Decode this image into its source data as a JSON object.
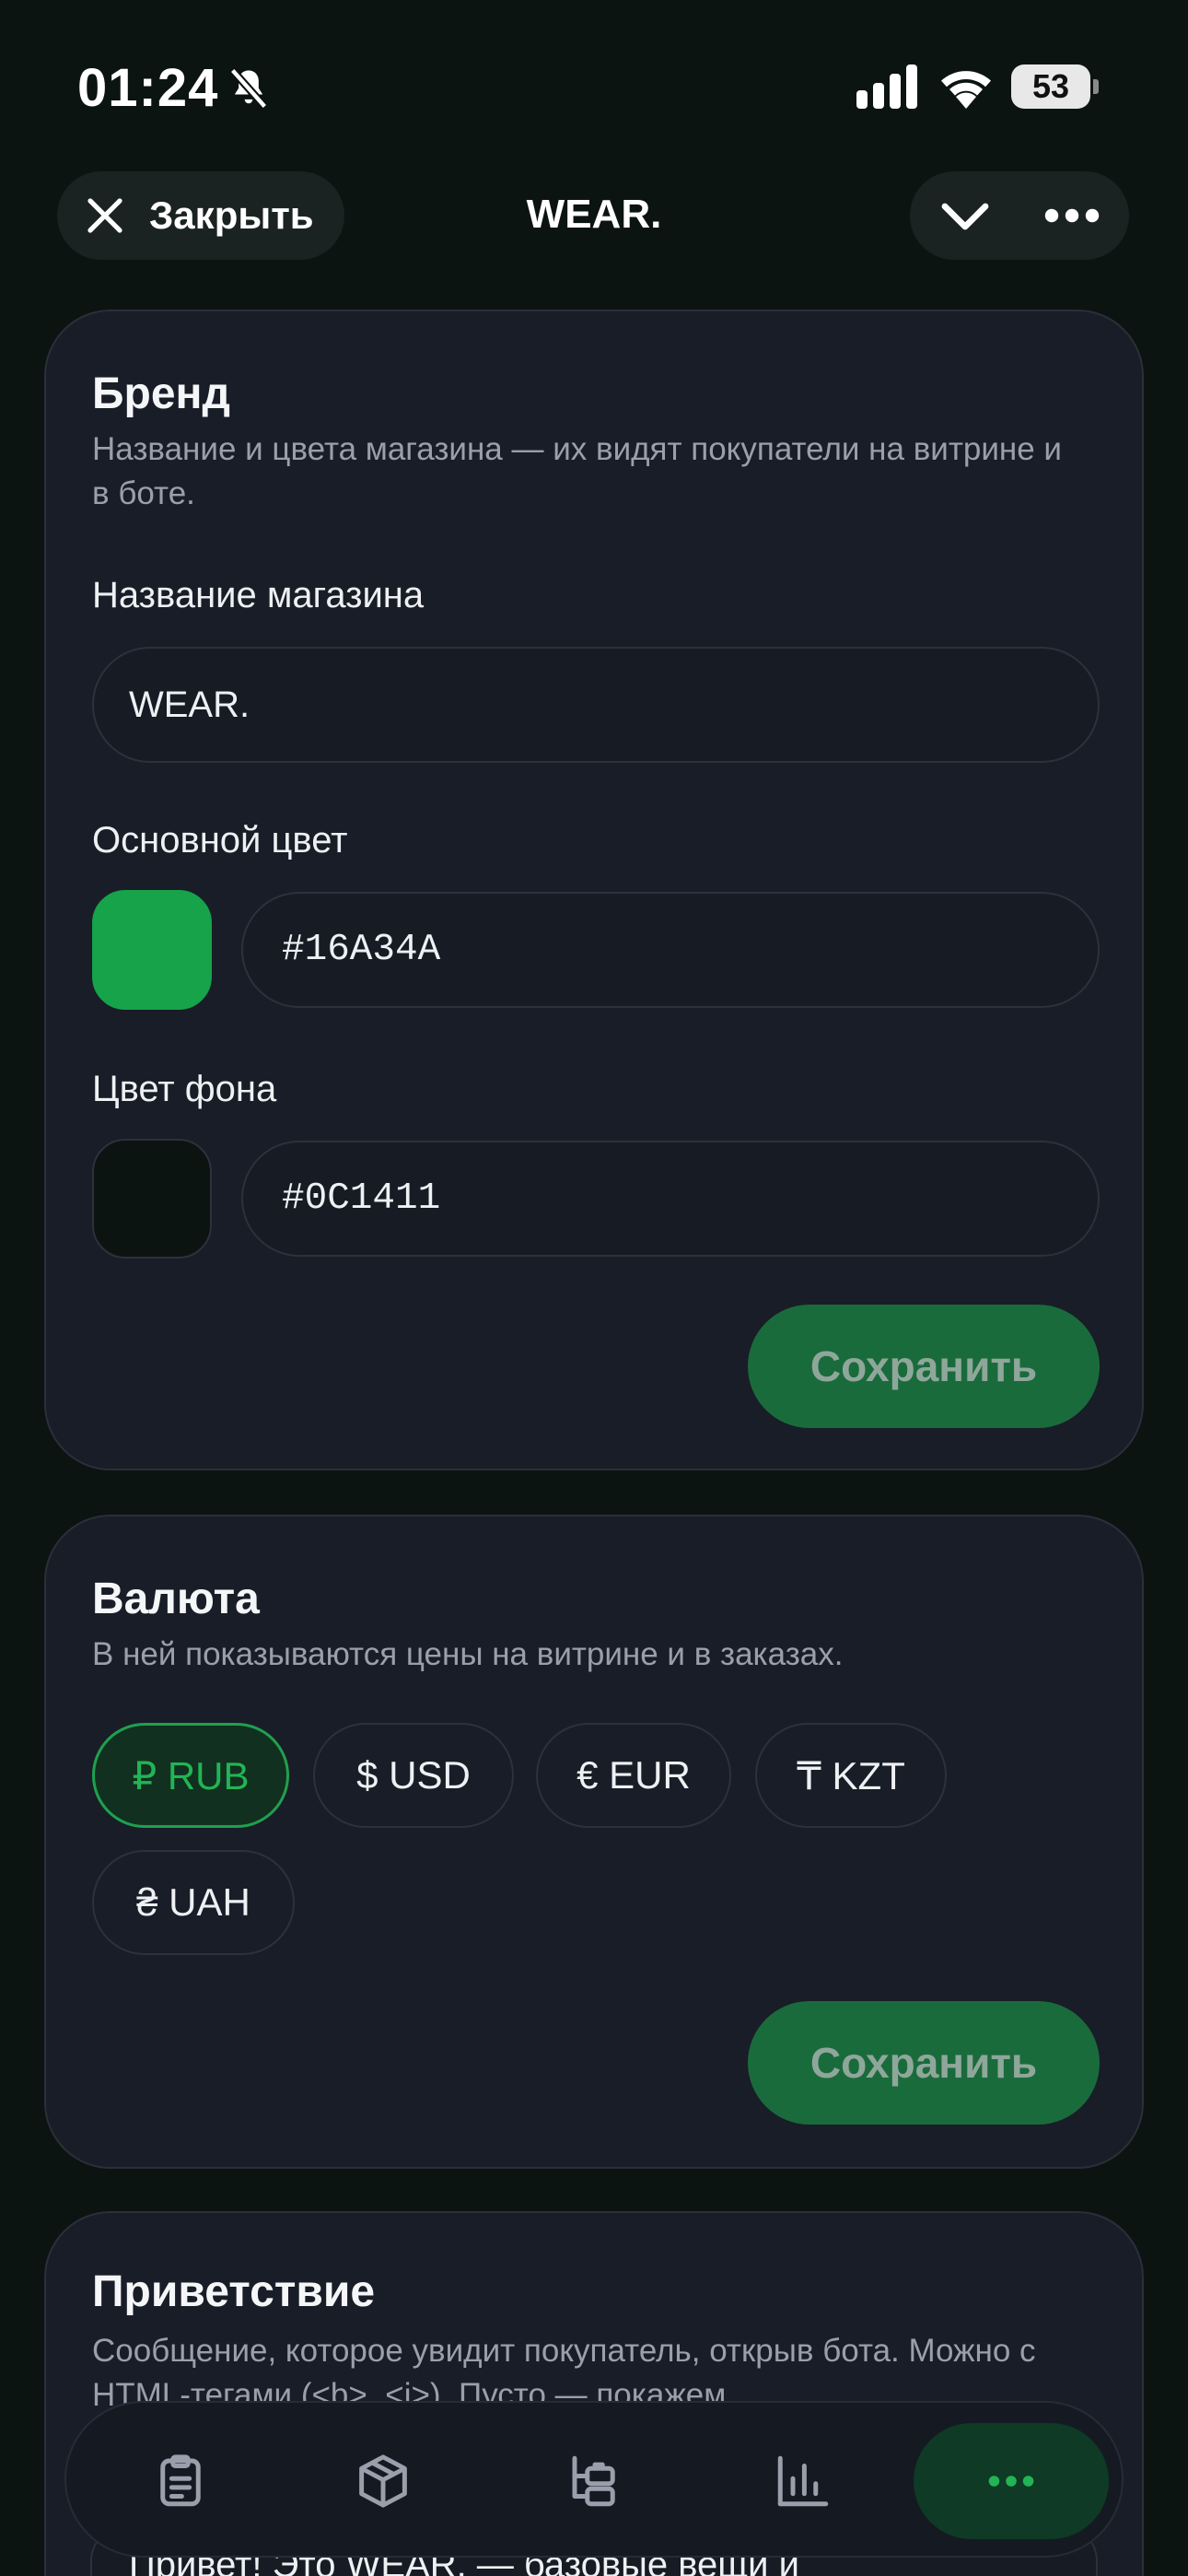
{
  "status_bar": {
    "time": "01:24",
    "battery": "53",
    "icons": [
      "bell-slash-icon",
      "signal-icon",
      "wifi-icon",
      "battery-icon"
    ]
  },
  "header": {
    "close_label": "Закрыть",
    "title": "WEAR.",
    "icons": [
      "close-icon",
      "chevron-down-icon",
      "more-icon"
    ]
  },
  "brand": {
    "title": "Бренд",
    "description": "Название и цвета магазина — их видят покупатели на витрине и в боте.",
    "store_name_label": "Название магазина",
    "store_name_value": "WEAR.",
    "primary_color_label": "Основной цвет",
    "primary_color_value": "#16A34A",
    "background_color_label": "Цвет фона",
    "background_color_value": "#0C1411",
    "save_label": "Сохранить"
  },
  "currency": {
    "title": "Валюта",
    "description": "В ней показываются цены на витрине и в заказах.",
    "options": [
      {
        "label": "₽ RUB",
        "selected": true
      },
      {
        "label": "$ USD",
        "selected": false
      },
      {
        "label": "€ EUR",
        "selected": false
      },
      {
        "label": "₸ KZT",
        "selected": false
      },
      {
        "label": "₴ UAH",
        "selected": false
      }
    ],
    "save_label": "Сохранить"
  },
  "greeting": {
    "title": "Приветствие",
    "description": "Сообщение, которое увидит покупатель, открыв бота. Можно с HTML-тегами (<b>, <i>). Пусто — покажем",
    "value": "Привет! Это WEAR. — базовые вещи и"
  },
  "bottom_nav": {
    "items": [
      {
        "icon": "clipboard-icon",
        "active": false
      },
      {
        "icon": "box-icon",
        "active": false
      },
      {
        "icon": "categories-icon",
        "active": false
      },
      {
        "icon": "chart-icon",
        "active": false
      },
      {
        "icon": "more-icon",
        "active": true
      }
    ]
  },
  "colors": {
    "accent": "#16A34A",
    "background": "#0C1411",
    "card": "#191D27"
  }
}
